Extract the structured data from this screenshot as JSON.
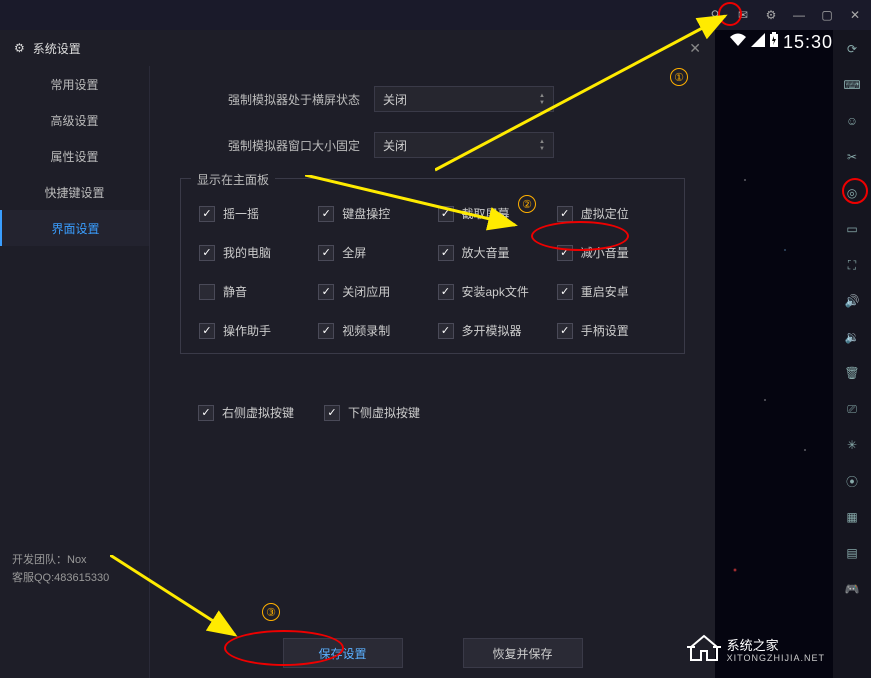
{
  "titlebar": {
    "icons": [
      "pin-icon",
      "mail-icon",
      "gear-icon",
      "minimize-icon",
      "maximize-icon",
      "close-icon"
    ]
  },
  "statusbar": {
    "time": "15:30"
  },
  "window": {
    "title": "系统设置"
  },
  "sidebar": {
    "items": [
      {
        "label": "常用设置",
        "active": false
      },
      {
        "label": "高级设置",
        "active": false
      },
      {
        "label": "属性设置",
        "active": false
      },
      {
        "label": "快捷键设置",
        "active": false
      },
      {
        "label": "界面设置",
        "active": true
      }
    ],
    "footer": {
      "dev_team": "开发团队：Nox",
      "support": "客服QQ:483615330"
    }
  },
  "content": {
    "row1": {
      "label": "强制模拟器处于横屏状态",
      "value": "关闭"
    },
    "row2": {
      "label": "强制模拟器窗口大小固定",
      "value": "关闭"
    },
    "group_title": "显示在主面板",
    "checks": [
      {
        "label": "摇一摇",
        "on": true
      },
      {
        "label": "键盘操控",
        "on": true
      },
      {
        "label": "截取屏幕",
        "on": true
      },
      {
        "label": "虚拟定位",
        "on": true
      },
      {
        "label": "我的电脑",
        "on": true
      },
      {
        "label": "全屏",
        "on": true
      },
      {
        "label": "放大音量",
        "on": true
      },
      {
        "label": "减小音量",
        "on": true
      },
      {
        "label": "静音",
        "on": false
      },
      {
        "label": "关闭应用",
        "on": true
      },
      {
        "label": "安装apk文件",
        "on": true
      },
      {
        "label": "重启安卓",
        "on": true
      },
      {
        "label": "操作助手",
        "on": true
      },
      {
        "label": "视频录制",
        "on": true
      },
      {
        "label": "多开模拟器",
        "on": true
      },
      {
        "label": "手柄设置",
        "on": true
      }
    ],
    "bottom_checks": [
      {
        "label": "右侧虚拟按键",
        "on": true
      },
      {
        "label": "下侧虚拟按键",
        "on": true
      }
    ],
    "save_btn": "保存设置",
    "restore_btn": "恢复并保存"
  },
  "right_toolbar": {
    "tools": [
      "rotate-icon",
      "keyboard-icon",
      "robot-icon",
      "scissors-icon",
      "location-icon",
      "computer-icon",
      "fullscreen-icon",
      "volume-up-icon",
      "volume-down-icon",
      "trash-icon",
      "apk-icon",
      "reticle-icon",
      "record-icon",
      "screenshot-icon",
      "multi-icon",
      "gamepad-icon"
    ]
  },
  "annotations": {
    "num1": "①",
    "num2": "②",
    "num3": "③"
  },
  "watermark": {
    "name": "系统之家",
    "url": "XITONGZHIJIA.NET"
  }
}
